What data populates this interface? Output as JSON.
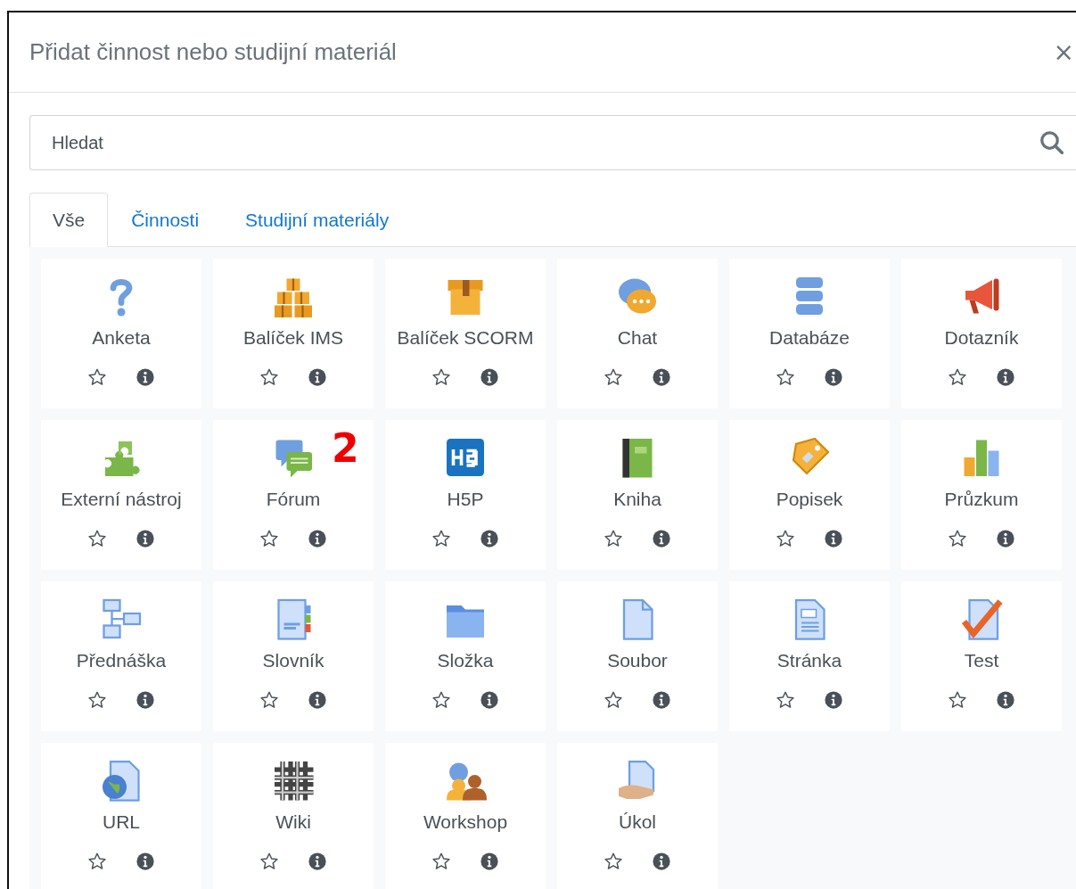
{
  "dialog": {
    "title": "Přidat činnost nebo studijní materiál",
    "close": "×"
  },
  "search": {
    "placeholder": "Hledat"
  },
  "tabs": [
    {
      "label": "Vše",
      "selected": true
    },
    {
      "label": "Činnosti",
      "selected": false
    },
    {
      "label": "Studijní materiály",
      "selected": false
    }
  ],
  "modules": [
    {
      "name": "Anketa",
      "kind": "question",
      "starred": false
    },
    {
      "name": "Balíček IMS",
      "kind": "boxes",
      "starred": false
    },
    {
      "name": "Balíček SCORM",
      "kind": "box",
      "starred": false
    },
    {
      "name": "Chat",
      "kind": "chat",
      "starred": false
    },
    {
      "name": "Databáze",
      "kind": "database",
      "starred": false
    },
    {
      "name": "Dotazník",
      "kind": "megaphone",
      "starred": false
    },
    {
      "name": "Externí nástroj",
      "kind": "puzzle",
      "starred": false
    },
    {
      "name": "Fórum",
      "kind": "forum",
      "starred": false,
      "annotation": "2"
    },
    {
      "name": "H5P",
      "kind": "h5p",
      "starred": false
    },
    {
      "name": "Kniha",
      "kind": "book",
      "starred": false
    },
    {
      "name": "Popisek",
      "kind": "tag",
      "starred": false
    },
    {
      "name": "Průzkum",
      "kind": "chart",
      "starred": false
    },
    {
      "name": "Přednáška",
      "kind": "flow",
      "starred": false
    },
    {
      "name": "Slovník",
      "kind": "glossary",
      "starred": false
    },
    {
      "name": "Složka",
      "kind": "folder",
      "starred": false
    },
    {
      "name": "Soubor",
      "kind": "file",
      "starred": false
    },
    {
      "name": "Stránka",
      "kind": "page",
      "starred": false
    },
    {
      "name": "Test",
      "kind": "check",
      "starred": false
    },
    {
      "name": "URL",
      "kind": "url",
      "starred": false
    },
    {
      "name": "Wiki",
      "kind": "wiki",
      "starred": false
    },
    {
      "name": "Workshop",
      "kind": "people",
      "starred": false
    },
    {
      "name": "Úkol",
      "kind": "assign",
      "starred": false
    }
  ]
}
